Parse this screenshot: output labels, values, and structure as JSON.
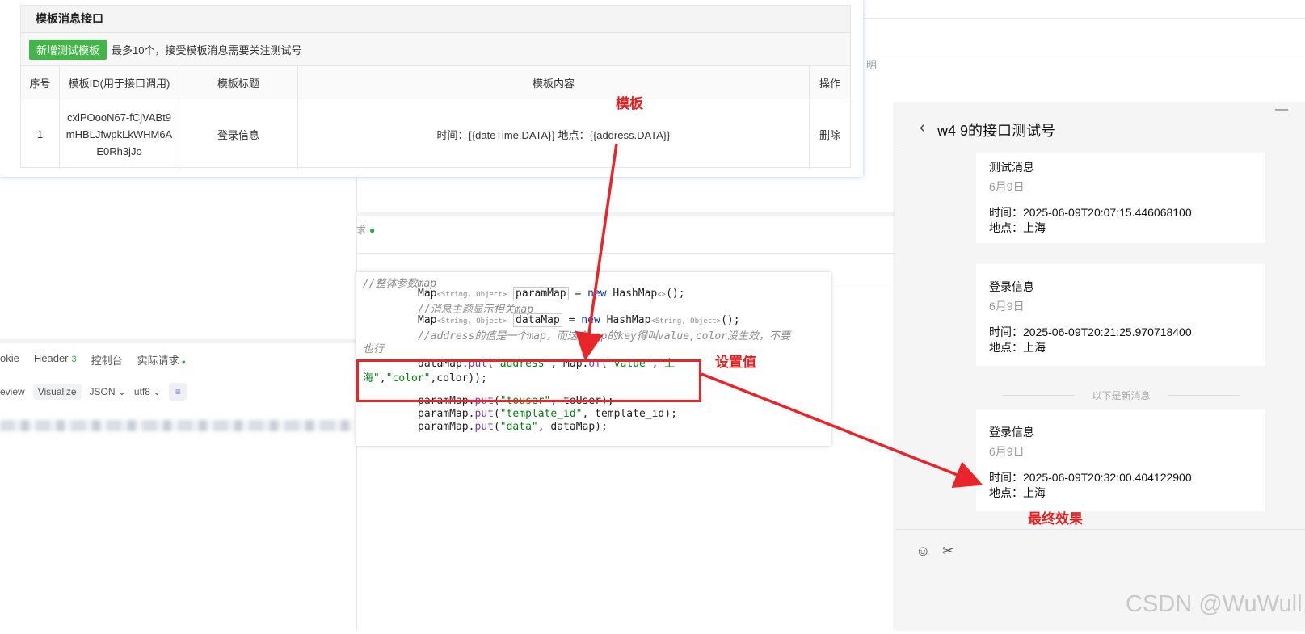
{
  "template_panel": {
    "title": "模板消息接口",
    "add_button": "新增测试模板",
    "hint": "最多10个，接受模板消息需要关注测试号",
    "columns": [
      "序号",
      "模板ID(用于接口调用)",
      "模板标题",
      "模板内容",
      "操作"
    ],
    "row": {
      "index": "1",
      "id_lines": [
        "cxlPOooN67-fCjVABt9",
        "mHBLJfwpkLkWHM6A",
        "E0Rh3jJo"
      ],
      "title": "登录信息",
      "content": "时间：{{dateTime.DATA}} 地点：{{address.DATA}}",
      "action": "删除"
    }
  },
  "background": {
    "fragment_right": "明",
    "status_fragment": "求",
    "left_tabs": [
      "okie",
      "Header",
      "控制台",
      "实际请求"
    ],
    "header_count": "3",
    "left_tools": [
      "eview",
      "Visualize",
      "JSON",
      "utf8"
    ]
  },
  "code": {
    "lines": [
      "//整体参数map",
      "Map<String, Object> paramMap = new HashMap<>();",
      "//消息主题显示相关map",
      "Map<String, Object> dataMap = new HashMap<String, Object>();",
      "//address的值是一个map，而这个map的key得叫value,color没生效，不要",
      "也行",
      "dataMap.put(\"address\", Map.of(\"value\",\"上",
      "海\",\"color\",color));",
      "paramMap.put(\"touser\", toUser);",
      "paramMap.put(\"template_id\", template_id);",
      "paramMap.put(\"data\", dataMap);"
    ]
  },
  "annotations": {
    "template_label": "模板",
    "set_value_label": "设置值",
    "final_label": "最终效果"
  },
  "chat": {
    "title": "w4    9的接口测试号",
    "messages": [
      {
        "title": "测试消息",
        "date": "6月9日",
        "time": "时间：2025-06-09T20:07:15.446068100",
        "place": "地点：上海"
      },
      {
        "title": "登录信息",
        "date": "6月9日",
        "time": "时间：2025-06-09T20:21:25.970718400",
        "place": "地点：上海"
      },
      {
        "title": "登录信息",
        "date": "6月9日",
        "time": "时间：2025-06-09T20:32:00.404122900",
        "place": "地点：上海"
      }
    ],
    "divider": "以下是新消息",
    "min_symbol": "—"
  },
  "watermark": "CSDN @WuWull",
  "colors": {
    "annotation_red": "#e8252a",
    "button_green": "#44b549",
    "link_blue": "#5b9bd5"
  }
}
